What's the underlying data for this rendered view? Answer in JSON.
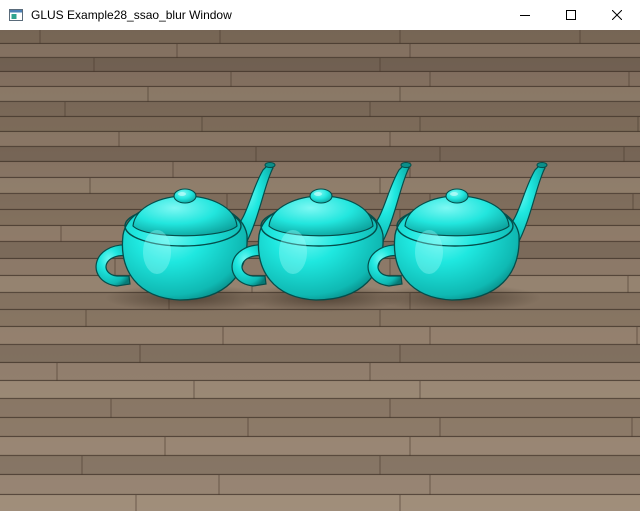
{
  "window": {
    "title": "GLUS Example28_ssao_blur Window",
    "icon": "app-window-icon"
  },
  "controls": {
    "minimize_icon": "minimize-icon",
    "maximize_icon": "maximize-icon",
    "close_icon": "close-icon"
  },
  "scene": {
    "object_count": 3,
    "object_color": "#19e3dc",
    "floor_color": "#8a7562"
  }
}
